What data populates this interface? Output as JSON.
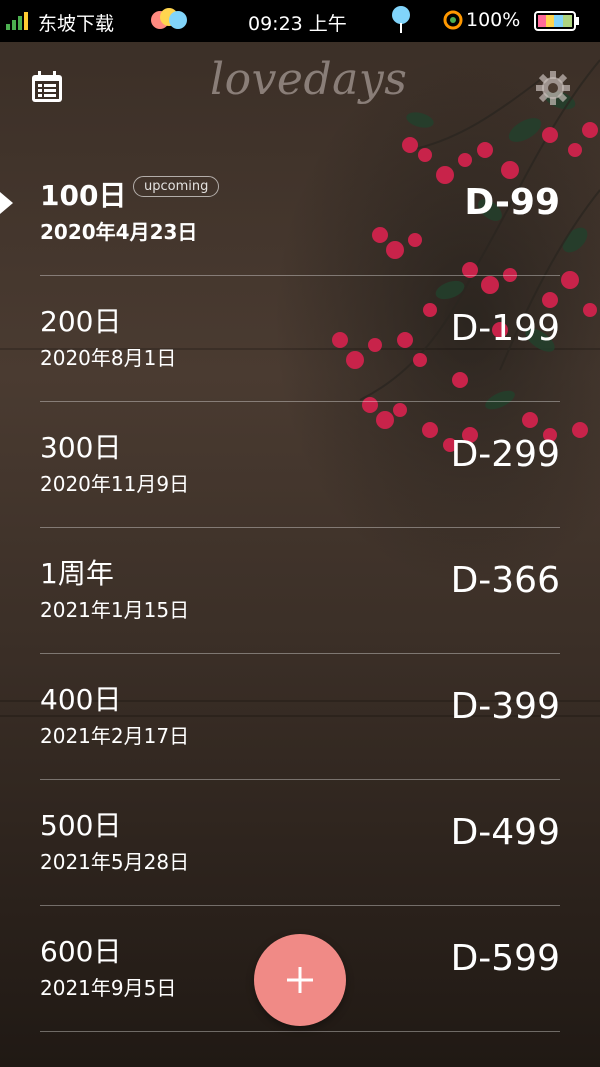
{
  "status_bar": {
    "carrier": "东坡下载",
    "time": "09:23 上午",
    "battery": "100%"
  },
  "app": {
    "logo": "lovedays"
  },
  "list": {
    "items": [
      {
        "title": "100日",
        "date": "2020年4月23日",
        "dday": "D-99",
        "badge": "upcoming"
      },
      {
        "title": "200日",
        "date": "2020年8月1日",
        "dday": "D-199"
      },
      {
        "title": "300日",
        "date": "2020年11月9日",
        "dday": "D-299"
      },
      {
        "title": "1周年",
        "date": "2021年1月15日",
        "dday": "D-366"
      },
      {
        "title": "400日",
        "date": "2021年2月17日",
        "dday": "D-399"
      },
      {
        "title": "500日",
        "date": "2021年5月28日",
        "dday": "D-499"
      },
      {
        "title": "600日",
        "date": "2021年9月5日",
        "dday": "D-599"
      }
    ]
  },
  "fab": {
    "icon": "plus-icon"
  },
  "colors": {
    "fab": "#f08a86",
    "text": "#ffffff",
    "flower": "#c8234a"
  }
}
